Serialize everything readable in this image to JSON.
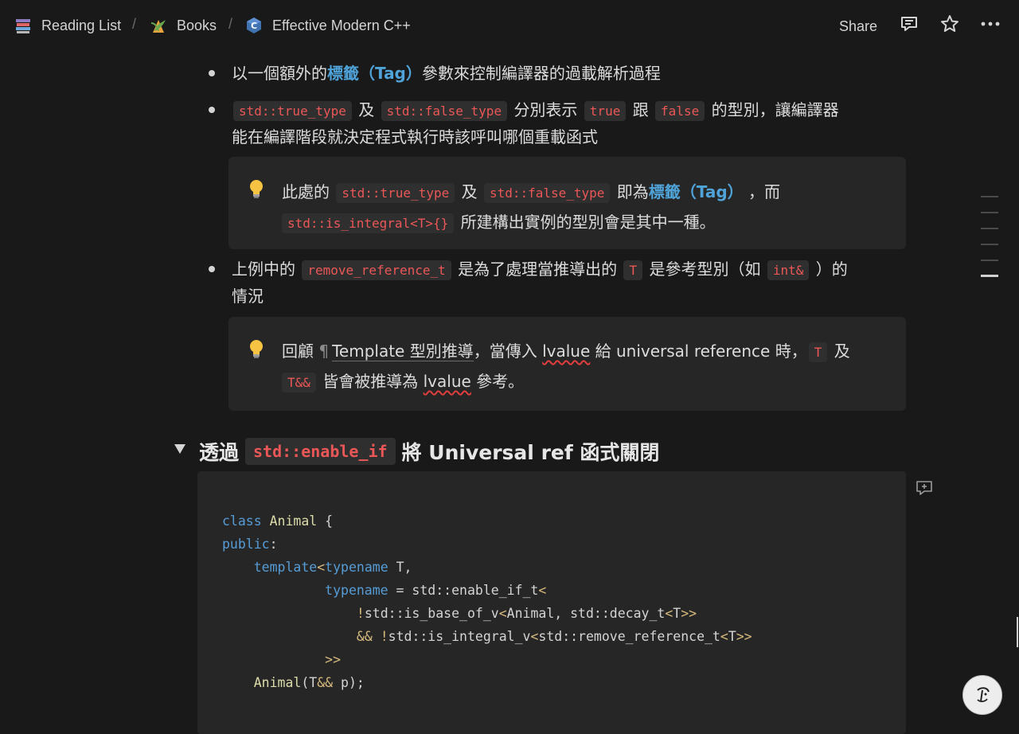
{
  "breadcrumb": {
    "items": [
      {
        "label": "Reading List",
        "icon": "books-stack-icon"
      },
      {
        "label": "Books",
        "icon": "plant-icon"
      },
      {
        "label": "Effective Modern C++",
        "icon": "cpp-logo-icon"
      }
    ],
    "separator": "/"
  },
  "header": {
    "share_label": "Share",
    "icons": [
      "comment-icon",
      "star-icon",
      "more-icon"
    ]
  },
  "bullets": {
    "b1": {
      "pre": "以一個額外的",
      "tag": "標籤（Tag）",
      "post": "參數來控制編譯器的過載解析過程"
    },
    "b2": {
      "code1": "std::true_type",
      "t1": "及",
      "code2": "std::false_type",
      "t2": "分別表示",
      "code3": "true",
      "t3": "跟",
      "code4": "false",
      "t4": "的型別，讓編譯器",
      "line2": "能在編譯階段就決定程式執行時該呼叫哪個重載函式"
    },
    "b3": {
      "t1": "上例中的",
      "code1": "remove_reference_t",
      "t2": "是為了處理當推導出的",
      "code2": "T",
      "t3": "是參考型別（如",
      "code3": "int&",
      "t4": "）的",
      "line2": "情況"
    }
  },
  "callouts": {
    "c1": {
      "icon": "lightbulb-icon",
      "t1": "此處的",
      "code1": "std::true_type",
      "t2": "及",
      "code2": "std::false_type",
      "t3": "即為",
      "tag": "標籤（Tag）",
      "t4": "，而",
      "code3": "std::is_integral<T>{}",
      "t5": "所建構出實例的型別會是其中一種。"
    },
    "c2": {
      "icon": "lightbulb-icon",
      "t1": "回顧",
      "pilcrow": "¶",
      "link": "Template 型別推導",
      "t2": "，當傳入",
      "lvalue1": "lvalue",
      "t3": "給 universal reference 時，",
      "code1": "T",
      "t4": "及",
      "code2": "T&&",
      "t5": "皆會被推導為",
      "lvalue2": "lvalue",
      "t6": "參考。"
    }
  },
  "section": {
    "t1": "透過",
    "code": "std::enable_if",
    "t2": "將 Universal ref 函式關閉"
  },
  "code": {
    "lines": [
      "class Animal {",
      "public:",
      "    template<typename T,",
      "             typename = std::enable_if_t<",
      "                 !std::is_base_of_v<Animal, std::decay_t<T>>",
      "                 && !std::is_integral_v<std::remove_reference_t<T>>",
      "             >>",
      "    Animal(T&& p);"
    ]
  }
}
